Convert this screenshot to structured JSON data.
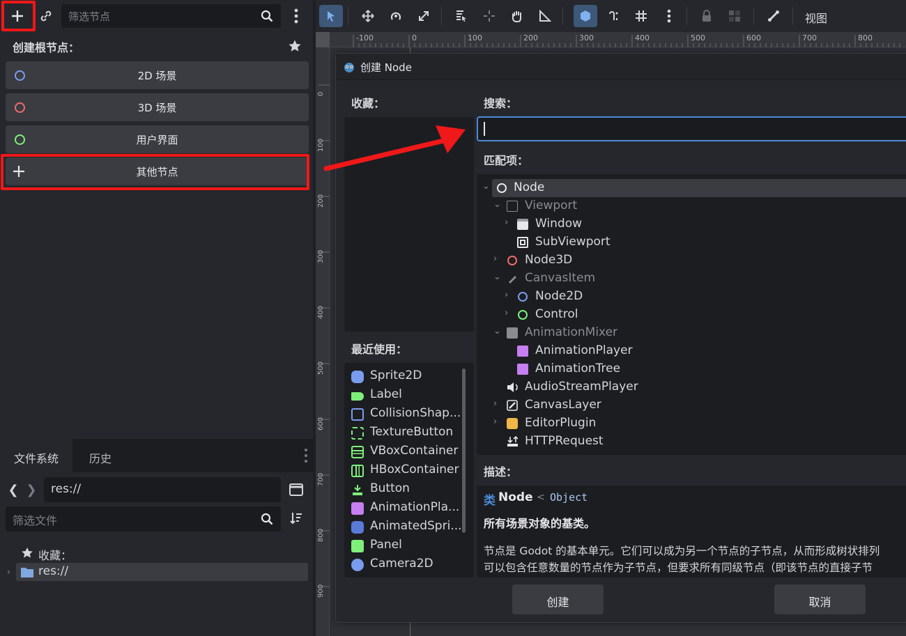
{
  "scene_dock": {
    "search_placeholder": "筛选节点",
    "create_root_label": "创建根节点：",
    "root_buttons": [
      "2D 场景",
      "3D 场景",
      "用户界面",
      "其他节点"
    ]
  },
  "filesystem": {
    "tabs": [
      "文件系统",
      "历史"
    ],
    "path": "res://",
    "filter_placeholder": "筛选文件",
    "favorites_label": "收藏：",
    "root_item": "res://"
  },
  "viewport": {
    "view_menu": "视图",
    "ruler_top": [
      "-100",
      "0",
      "100",
      "200",
      "300",
      "400",
      "500",
      "600",
      "700",
      "800"
    ],
    "ruler_left": [
      "0",
      "100",
      "200",
      "300",
      "400",
      "500",
      "600",
      "700",
      "800",
      "900"
    ]
  },
  "dialog": {
    "title": "创建 Node",
    "favorites_label": "收藏：",
    "search_label": "搜索：",
    "matches_label": "匹配项：",
    "recent_label": "最近使用：",
    "description_label": "描述：",
    "tree": [
      "Node",
      "Viewport",
      "Window",
      "SubViewport",
      "Node3D",
      "CanvasItem",
      "Node2D",
      "Control",
      "AnimationMixer",
      "AnimationPlayer",
      "AnimationTree",
      "AudioStreamPlayer",
      "CanvasLayer",
      "EditorPlugin",
      "HTTPRequest"
    ],
    "recent": [
      "Sprite2D",
      "Label",
      "CollisionShap...",
      "TextureButton",
      "VBoxContainer",
      "HBoxContainer",
      "Button",
      "AnimationPla...",
      "AnimatedSpri...",
      "Panel",
      "Camera2D"
    ],
    "desc_class_kw": "类",
    "desc_class_name": "Node",
    "desc_inherits_sym": "<",
    "desc_inherits": "Object",
    "desc_brief": "所有场景对象的基类。",
    "desc_line1": "节点是 Godot 的基本单元。它们可以成为另一个节点的子节点，从而形成树状排列",
    "desc_line2": "可以包含任意数量的节点作为子节点，但要求所有同级节点（即该节点的直接子节",
    "create_button": "创建",
    "cancel_button": "取消"
  },
  "colors": {
    "accent": "#4d8bd8",
    "annotation": "#f01818",
    "node2d": "#7a9cef",
    "node3d": "#f06a6a",
    "control": "#7ef07a"
  }
}
